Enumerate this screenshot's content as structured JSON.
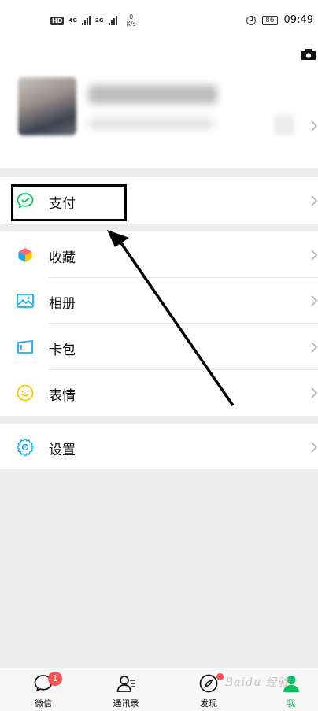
{
  "status_bar": {
    "hd_badge": "HD",
    "net1": "4G",
    "net2": "2G",
    "speed_value": "0",
    "speed_unit": "K/s",
    "battery": "86",
    "time": "09:49"
  },
  "menu": {
    "pay": "支付",
    "favorites": "收藏",
    "album": "相册",
    "cards": "卡包",
    "stickers": "表情",
    "settings": "设置"
  },
  "tabs": [
    {
      "label": "微信",
      "badge": "1"
    },
    {
      "label": "通讯录"
    },
    {
      "label": "发现"
    },
    {
      "label": "我"
    }
  ],
  "colors": {
    "accent": "#07c160",
    "badge": "#fa5151",
    "annotation": "#000000"
  },
  "icons": {
    "pay": "wechat-pay-icon",
    "favorites": "cube-icon",
    "album": "picture-icon",
    "cards": "card-icon",
    "stickers": "smiley-icon",
    "settings": "gear-icon"
  },
  "watermark": "Baidu 经验"
}
